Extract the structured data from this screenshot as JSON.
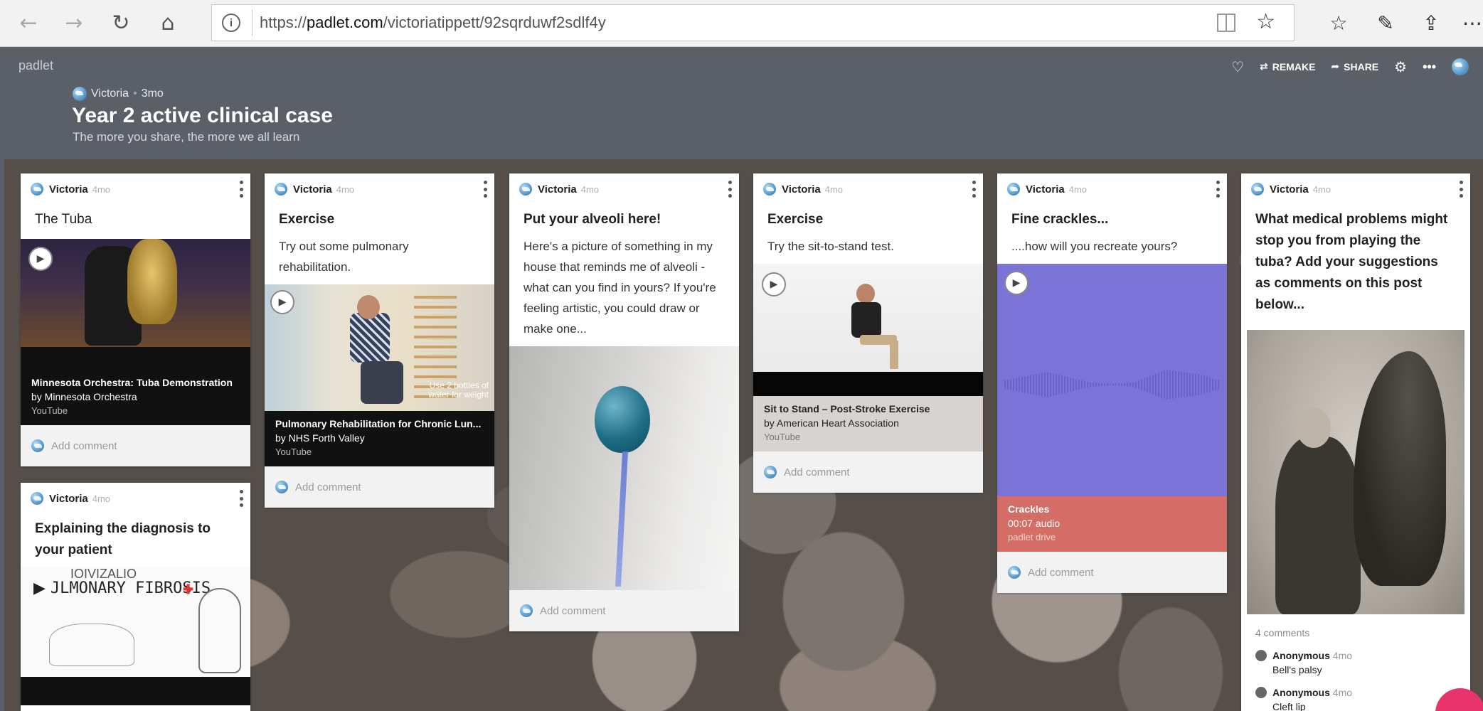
{
  "browser": {
    "url_prefix": "https://",
    "url_domain": "padlet.com",
    "url_path": "/victoriatippett/92sqrduwf2sdlf4y",
    "icons": [
      "back-icon",
      "forward-icon",
      "refresh-icon",
      "home-icon",
      "info-icon",
      "reading-view-icon",
      "favorite-star-icon",
      "favorites-list-icon",
      "pen-icon",
      "share-icon",
      "more-icon"
    ]
  },
  "padlet": {
    "logo": "padlet",
    "remake": "REMAKE",
    "share": "SHARE",
    "author": "Victoria",
    "age": "3mo",
    "title": "Year 2 active clinical case",
    "subtitle": "The more you share, the more we all learn"
  },
  "common": {
    "add_comment": "Add comment",
    "age": "4mo",
    "author": "Victoria"
  },
  "cards": {
    "tuba": {
      "title": "The Tuba",
      "video_title": "Minnesota Orchestra: Tuba Demonstration",
      "video_by": "by Minnesota Orchestra",
      "video_source": "YouTube"
    },
    "diagnosis": {
      "title": "Explaining the diagnosis to your patient",
      "thumb_text": "JLMONARY FIBROSIS",
      "thumb_top": "IOIVIZALIO"
    },
    "exercise1": {
      "title": "Exercise",
      "body": "Try out some pulmonary rehabilitation.",
      "overlay": "Use 2 bottles of water for weight",
      "video_title": "Pulmonary Rehabilitation for Chronic Lun...",
      "video_by": "by NHS Forth Valley",
      "video_source": "YouTube"
    },
    "alveoli": {
      "title": "Put your alveoli here!",
      "body": "Here's a picture of something in my house that reminds me of alveoli - what can you find in yours?  If you're feeling artistic, you could draw or make one..."
    },
    "exercise2": {
      "title": "Exercise",
      "body": "Try the sit-to-stand test.",
      "video_title": "Sit to Stand – Post-Stroke Exercise",
      "video_by": "by American Heart Association",
      "video_source": "YouTube"
    },
    "crackles": {
      "title": "Fine crackles...",
      "body": "....how will you recreate yours?",
      "audio_title": "Crackles",
      "audio_meta": "00:07 audio",
      "audio_source": "padlet drive"
    },
    "tuba2": {
      "title": "What medical problems might stop you from playing the tuba? Add your suggestions as comments on this post below...",
      "comments_count": "4 comments",
      "comments": [
        {
          "author": "Anonymous",
          "age": "4mo",
          "text": "Bell's palsy"
        },
        {
          "author": "Anonymous",
          "age": "4mo",
          "text": "Cleft lip"
        }
      ]
    }
  }
}
